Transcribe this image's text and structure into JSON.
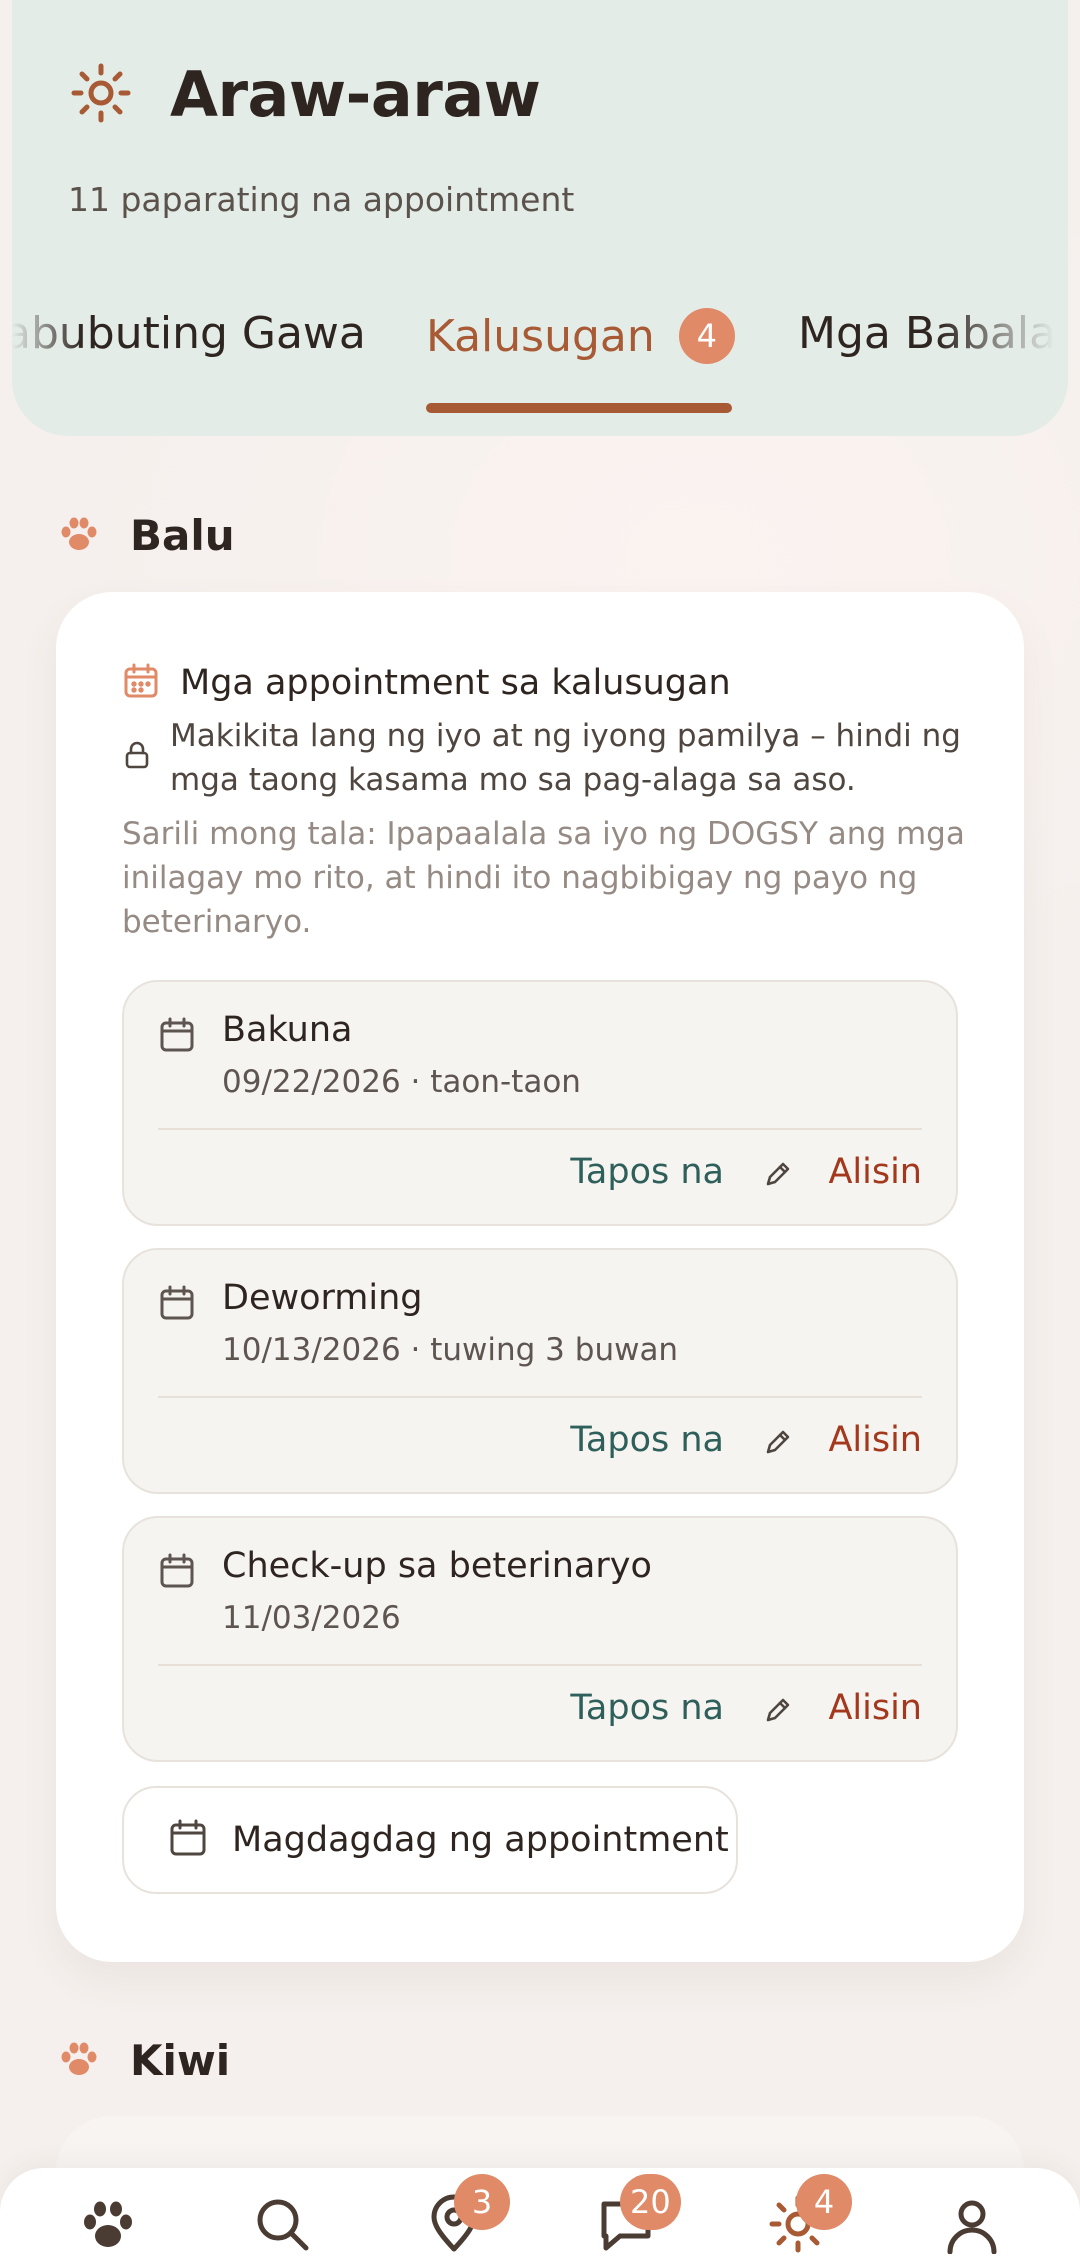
{
  "header": {
    "icon": "sun-icon",
    "title": "Araw-araw",
    "subtitle": "11 paparating na appointment"
  },
  "tabs": [
    {
      "label": "abubuting Gawa"
    },
    {
      "label": "Kalusugan",
      "badge": "4",
      "active": true
    },
    {
      "label": "Mga Babala"
    }
  ],
  "pets": [
    {
      "name": "Balu",
      "icon": "paw-icon"
    },
    {
      "name": "Kiwi",
      "icon": "paw-icon"
    }
  ],
  "card": {
    "title": "Mga appointment sa kalusugan",
    "privacy_note": "Makikita lang ng iyo at ng iyong pamilya – hindi ng mga taong kasama mo sa pag-alaga sa aso.",
    "disclaimer": "Sarili mong tala: Ipapaalala sa iyo ng DOGSY ang mga inilagay mo rito, at hindi ito nagbibigay ng payo ng beterinaryo.",
    "appointments": [
      {
        "title": "Bakuna",
        "meta": "09/22/2026 · taon-taon",
        "done_label": "Tapos na",
        "delete_label": "Alisin"
      },
      {
        "title": "Deworming",
        "meta": "10/13/2026 · tuwing 3 buwan",
        "done_label": "Tapos na",
        "delete_label": "Alisin"
      },
      {
        "title": "Check-up sa beterinaryo",
        "meta": "11/03/2026",
        "done_label": "Tapos na",
        "delete_label": "Alisin"
      }
    ],
    "add_label": "Magdagdag ng appointment"
  },
  "bottom_nav": [
    {
      "icon": "paw-icon"
    },
    {
      "icon": "search-icon"
    },
    {
      "icon": "map-pin-icon",
      "badge": "3"
    },
    {
      "icon": "chat-icon",
      "badge": "20"
    },
    {
      "icon": "sun-icon",
      "badge": "4"
    },
    {
      "icon": "profile-icon"
    }
  ],
  "colors": {
    "accent": "#a85a34",
    "badge": "#e08a68",
    "header_bg": "#e4ece8",
    "done": "#2f5f5a",
    "delete": "#a3381d"
  }
}
